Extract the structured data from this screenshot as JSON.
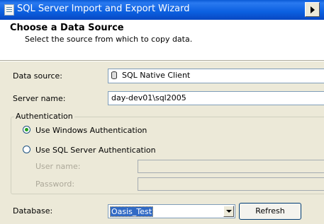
{
  "window": {
    "title": "SQL Server Import and Export Wizard"
  },
  "header": {
    "title": "Choose a Data Source",
    "subtitle": "Select the source from which to copy data."
  },
  "form": {
    "data_source_label": "Data source:",
    "data_source_value": "SQL Native Client",
    "server_name_label": "Server name:",
    "server_name_value": "day-dev01\\sql2005",
    "auth_group_label": "Authentication",
    "windows_auth_label": "Use Windows Authentication",
    "windows_auth_checked": true,
    "sql_auth_label": "Use SQL Server Authentication",
    "sql_auth_checked": false,
    "user_name_label": "User name:",
    "user_name_value": "",
    "password_label": "Password:",
    "password_value": "",
    "database_label": "Database:",
    "database_value": "Oasis_Test",
    "refresh_label": "Refresh"
  },
  "icons": [
    "app-icon",
    "database-icon",
    "chevron-right-icon",
    "chevron-down-icon"
  ]
}
